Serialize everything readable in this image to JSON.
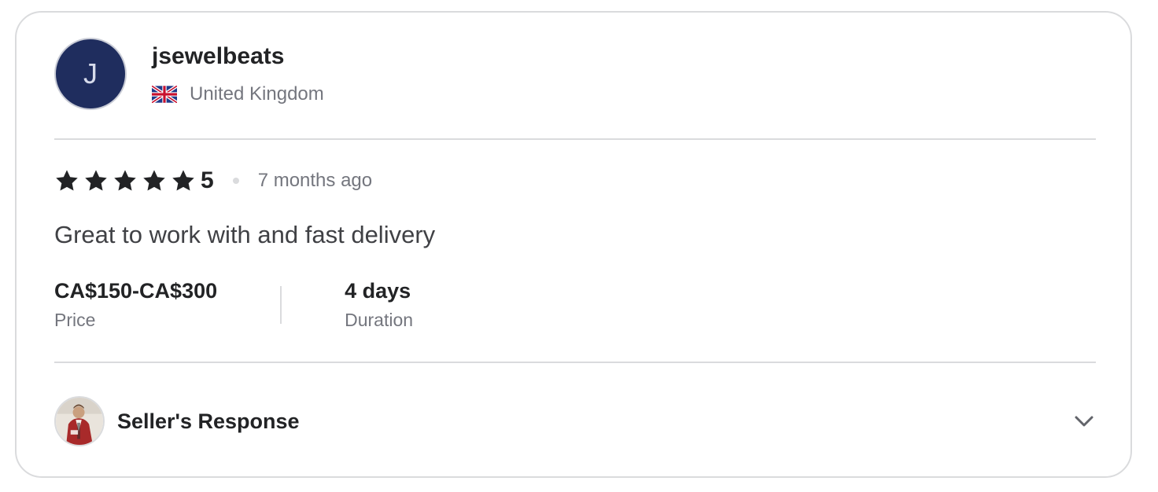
{
  "reviewer": {
    "initial": "J",
    "username": "jsewelbeats",
    "country": "United Kingdom",
    "avatar_color": "#1f2d5e"
  },
  "review": {
    "stars": 5,
    "rating": "5",
    "time_ago": "7 months ago",
    "text": "Great to work with and fast delivery"
  },
  "meta": {
    "price_value": "CA$150-CA$300",
    "price_label": "Price",
    "duration_value": "4 days",
    "duration_label": "Duration"
  },
  "seller_response": {
    "label": "Seller's Response",
    "toggle_icon": "chevron-down-icon"
  }
}
